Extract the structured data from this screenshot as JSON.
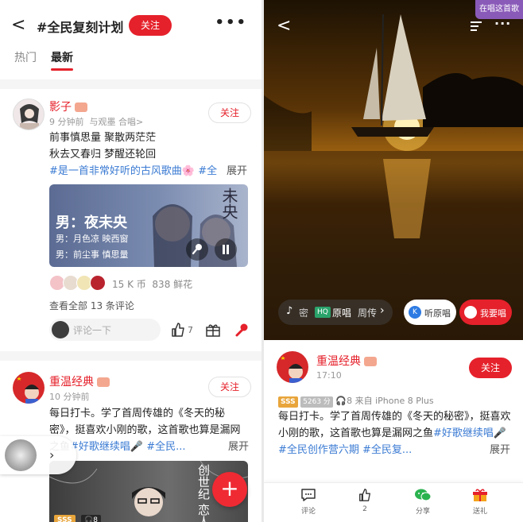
{
  "left": {
    "header": {
      "back": "<",
      "title": "#全民复刻计划",
      "follow": "关注",
      "more": "•••"
    },
    "tabs": [
      {
        "label": "热门"
      },
      {
        "label": "最新"
      }
    ],
    "post1": {
      "user": "影子",
      "time": "9 分钟前",
      "with": "与观墨 合唱>",
      "follow": "关注",
      "lines": [
        "前事慎思量  聚散两茫茫",
        "秋去又春归  梦醒还轮回"
      ],
      "tag": "#是一首非常好听的古风歌曲🌸 #全",
      "expand": "展开",
      "card": {
        "title": "男：夜未央",
        "line1": "男：月色凉 映西窗",
        "line2": "男：前尘事 慎思量",
        "art": "未央"
      },
      "coins": "15 K 币",
      "flowers": "838 鲜花",
      "comments": "查看全部 13 条评论",
      "comment_placeholder": "评论一下",
      "likes": "7"
    },
    "post2": {
      "user": "重温经典",
      "time": "10 分钟前",
      "follow": "关注",
      "text": "每日打卡。学了首周传雄的《冬天的秘密》，挺喜欢小刚的歌，这首歌也算是漏网之鱼",
      "tag": "#好歌继续唱🎤 #全民...",
      "expand": "展开",
      "card_badge": "SSS",
      "card_count": "8",
      "card_art": "创世纪 恋人"
    },
    "fab": "+"
  },
  "right": {
    "back": "<",
    "now_singing": "在唱这首歌",
    "song_chip": {
      "song": "密",
      "hq": "HQ",
      "original": "原唱",
      "singer": "周传"
    },
    "listen_original": "听原唱",
    "i_sing": "我要唱",
    "post": {
      "user": "重温经典",
      "time": "17:10",
      "follow": "关注",
      "badge": "SSS",
      "score": "5263 分",
      "count": "8",
      "device": "来自 iPhone 8 Plus",
      "text_before": "每日打卡。学了首周传雄的《冬天的秘密》，挺喜欢小刚的歌，这首歌也算是漏网之鱼",
      "tag1": "#好歌继续唱",
      "tag2": "🎤 #全民创作营六期 #全民复...",
      "expand": "展开"
    },
    "bottom_nav": [
      {
        "label": "评论"
      },
      {
        "label": "2"
      },
      {
        "label": "分享"
      },
      {
        "label": "送礼"
      }
    ]
  }
}
